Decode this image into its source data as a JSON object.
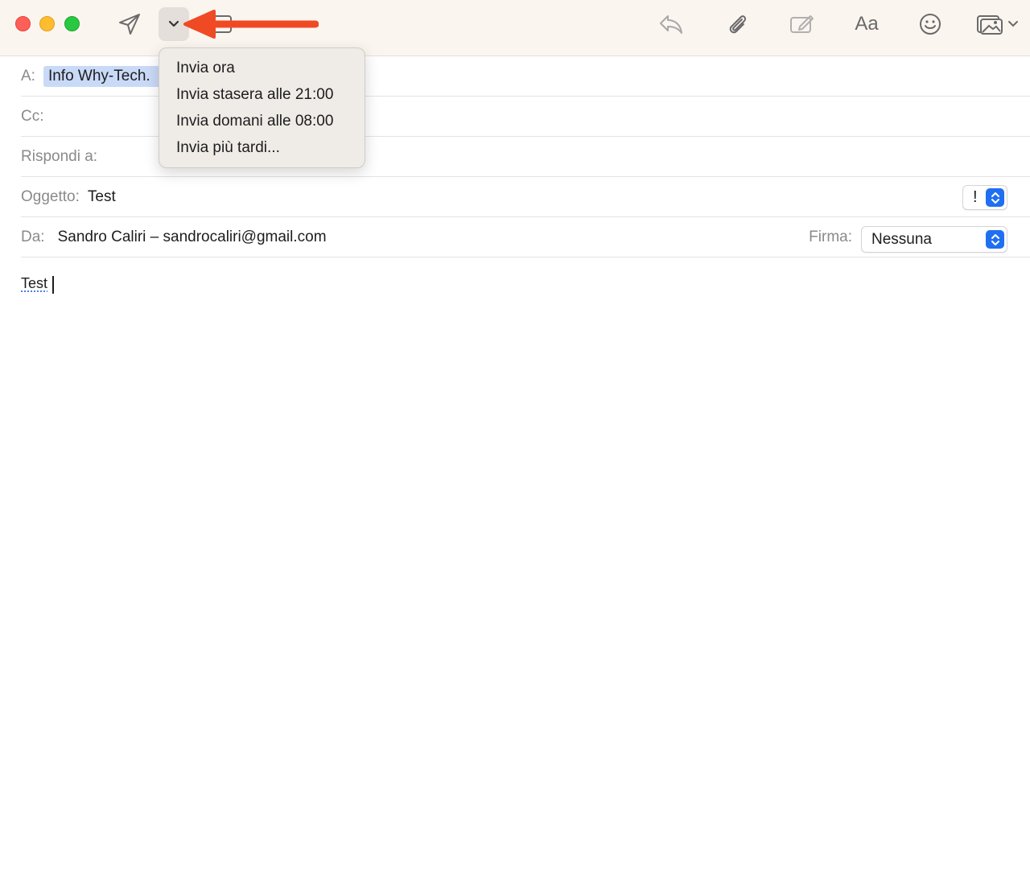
{
  "toolbar": {
    "format_label": "Aa"
  },
  "send_menu": {
    "items": [
      {
        "label": "Invia ora"
      },
      {
        "label": "Invia stasera alle 21:00"
      },
      {
        "label": "Invia domani alle 08:00"
      },
      {
        "label": "Invia più tardi..."
      }
    ]
  },
  "header": {
    "to_label": "A:",
    "to_recipient": "Info Why-Tech.",
    "cc_label": "Cc:",
    "reply_to_label": "Rispondi a:",
    "subject_label": "Oggetto:",
    "subject_value": "Test",
    "priority_value": "!",
    "from_label": "Da:",
    "from_value": "Sandro Caliri – sandrocaliri@gmail.com",
    "signature_label": "Firma:",
    "signature_value": "Nessuna"
  },
  "body": {
    "text": "Test"
  },
  "colors": {
    "toolbar_bg": "#fbf5f0",
    "accent_blue": "#1f6ff2",
    "annotation_red": "#f04a25",
    "close": "#fe5f57",
    "minimize": "#febc2e",
    "maximize": "#28c840"
  }
}
